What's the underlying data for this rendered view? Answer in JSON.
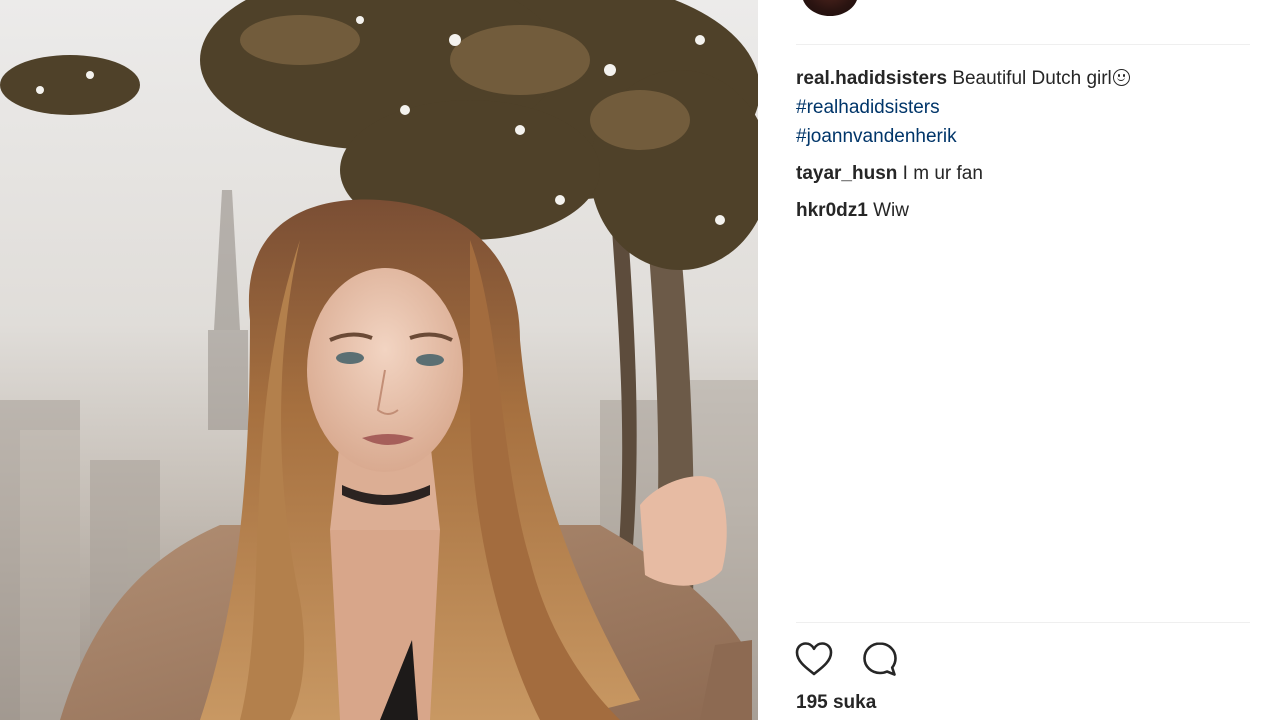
{
  "post": {
    "likes_count": "195",
    "likes_label": "suka"
  },
  "caption": {
    "username": "real.hadidsisters",
    "text": "Beautiful Dutch girl",
    "emoji": "slightly-smiling-face-icon",
    "hashtags": [
      "#realhadidsisters",
      "#joannvandenherik"
    ]
  },
  "comments": [
    {
      "username": "tayar_husn",
      "text": "I m ur fan"
    },
    {
      "username": "hkr0dz1",
      "text": "Wiw"
    }
  ],
  "actions": {
    "like_icon": "heart-icon",
    "comment_icon": "comment-bubble-icon"
  },
  "colors": {
    "text": "#262626",
    "hashtag": "#003569",
    "divider": "#efefef"
  }
}
